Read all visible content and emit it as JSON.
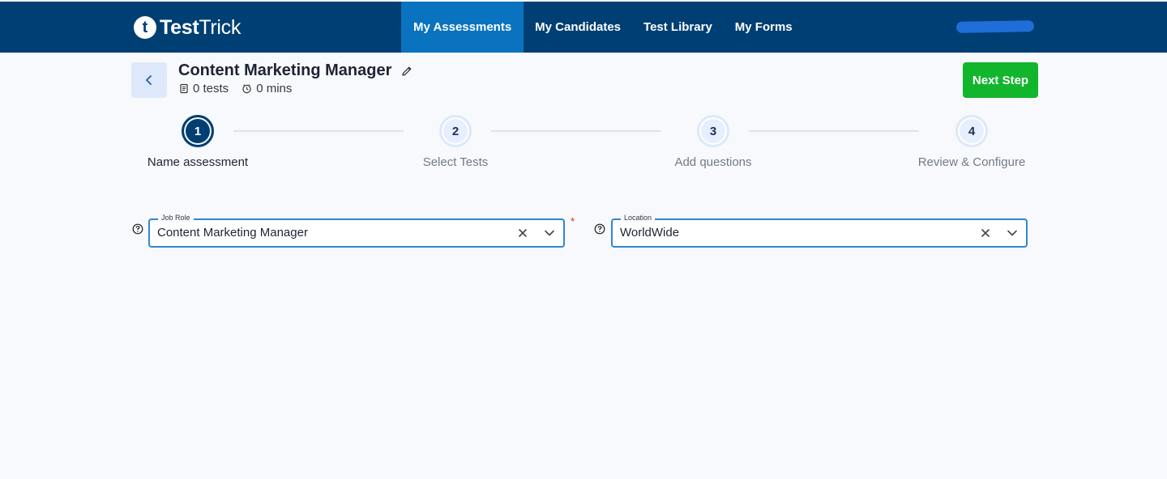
{
  "brand": {
    "mark": "t",
    "name_bold": "Test",
    "name_light": "Trick"
  },
  "nav": {
    "items": [
      {
        "label": "My Assessments",
        "active": true
      },
      {
        "label": "My Candidates",
        "active": false
      },
      {
        "label": "Test Library",
        "active": false
      },
      {
        "label": "My Forms",
        "active": false
      }
    ]
  },
  "header": {
    "title": "Content Marketing Manager",
    "tests": "0 tests",
    "duration": "0 mins",
    "next_label": "Next Step"
  },
  "stepper": {
    "steps": [
      {
        "number": "1",
        "label": "Name assessment",
        "state": "active"
      },
      {
        "number": "2",
        "label": "Select Tests",
        "state": "todo"
      },
      {
        "number": "3",
        "label": "Add questions",
        "state": "todo"
      },
      {
        "number": "4",
        "label": "Review & Configure",
        "state": "todo"
      }
    ]
  },
  "form": {
    "job_role": {
      "label": "Job Role",
      "value": "Content Marketing Manager",
      "required_mark": "*"
    },
    "location": {
      "label": "Location",
      "value": "WorldWide"
    }
  },
  "colors": {
    "nav_bg": "#003f73",
    "nav_active": "#0a73bf",
    "accent_green": "#12b62d",
    "field_border": "#2f86d6"
  },
  "icons": [
    "back-arrow-icon",
    "pencil-icon",
    "document-icon",
    "clock-icon",
    "question-circle-icon",
    "close-icon",
    "chevron-down-icon"
  ]
}
